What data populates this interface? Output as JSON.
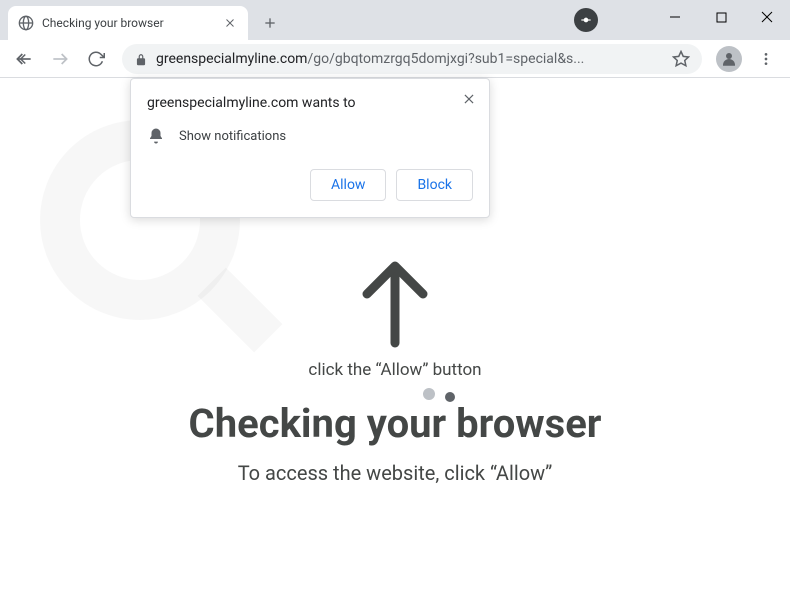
{
  "tab": {
    "title": "Checking your browser"
  },
  "toolbar": {
    "url_domain": "greenspecialmyline.com",
    "url_path": "/go/gbqtomzrgq5domjxgi?sub1=special&s..."
  },
  "popup": {
    "title": "greenspecialmyline.com wants to",
    "permission_label": "Show notifications",
    "allow": "Allow",
    "block": "Block"
  },
  "page": {
    "hint": "click the “Allow” button",
    "heading": "Checking your browser",
    "subheading": "To access the website, click “Allow”"
  }
}
